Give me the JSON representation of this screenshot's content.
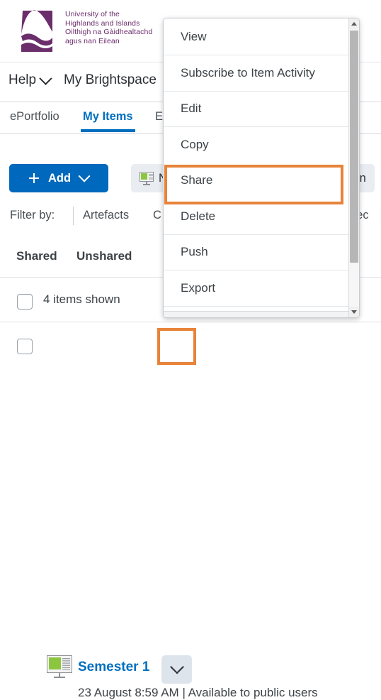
{
  "header": {
    "logo_icon": "uhi-mountain-logo",
    "logo_color": "#6b2d6b",
    "org_line1": "University of the",
    "org_line2": "Highlands and Islands",
    "org_line3": "Oilthigh na Gàidhealtachd",
    "org_line4": "agus nan Eilean"
  },
  "nav": {
    "help_label": "Help",
    "help_chevron_icon": "chevron-down-icon",
    "brightspace_label": "My Brightspace"
  },
  "tabs": [
    {
      "label": "ePortfolio",
      "active": false
    },
    {
      "label": "My Items",
      "active": true
    },
    {
      "label": "E",
      "active": false
    }
  ],
  "toolbar": {
    "add_label": "Add",
    "add_plus_icon": "plus-icon",
    "add_chevron_icon": "chevron-down-icon",
    "add_color": "#0069bd",
    "new_presentation_label": "N",
    "new_presentation_icon": "presentation-icon",
    "actions_label": "ction"
  },
  "filter": {
    "label": "Filter by:",
    "items": [
      "Artefacts",
      "C",
      "flec"
    ]
  },
  "share_tabs": [
    {
      "label": "Shared"
    },
    {
      "label": "Unshared"
    }
  ],
  "items_header": {
    "select_all_checkbox": "unchecked",
    "count_label": "4 items shown"
  },
  "item": {
    "checkbox": "unchecked",
    "icon": "presentation-icon",
    "title": "Semester 1",
    "chevron_icon": "chevron-down-icon",
    "meta": "23 August 8:59 AM | Available to public users"
  },
  "menu": {
    "items": [
      {
        "label": "View",
        "highlighted": false
      },
      {
        "label": "Subscribe to Item Activity",
        "highlighted": false
      },
      {
        "label": "Edit",
        "highlighted": false
      },
      {
        "label": "Copy",
        "highlighted": false
      },
      {
        "label": "Share",
        "highlighted": true
      },
      {
        "label": "Delete",
        "highlighted": false
      },
      {
        "label": "Push",
        "highlighted": false
      },
      {
        "label": "Export",
        "highlighted": false
      }
    ],
    "scrollbar": {
      "up_arrow_icon": "scroll-up-arrow-icon",
      "down_arrow_icon": "scroll-down-arrow-icon"
    }
  },
  "annotation": {
    "highlight_color": "#e8833a",
    "targets": [
      "Share",
      "Semester 1 dropdown chevron"
    ]
  }
}
